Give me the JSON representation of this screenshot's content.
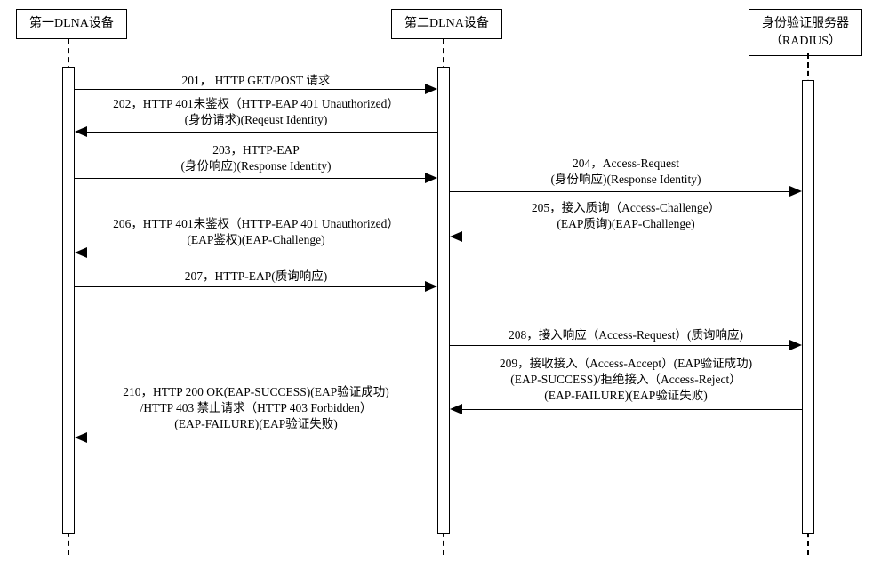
{
  "participants": {
    "p1": "第一DLNA设备",
    "p2": "第二DLNA设备",
    "p3_line1": "身份验证服务器",
    "p3_line2": "（RADIUS）"
  },
  "messages": {
    "m201": "201， HTTP GET/POST 请求",
    "m202_l1": "202，HTTP 401未鉴权（HTTP-EAP 401 Unauthorized）",
    "m202_l2": "(身份请求)(Reqeust Identity)",
    "m203_l1": "203，HTTP-EAP",
    "m203_l2": "(身份响应)(Response Identity)",
    "m204_l1": "204，Access-Request",
    "m204_l2": "(身份响应)(Response Identity)",
    "m205_l1": "205，接入质询（Access-Challenge）",
    "m205_l2": "(EAP质询)(EAP-Challenge)",
    "m206_l1": "206，HTTP 401未鉴权（HTTP-EAP 401 Unauthorized）",
    "m206_l2": "(EAP鉴权)(EAP-Challenge)",
    "m207": "207，HTTP-EAP(质询响应)",
    "m208": "208，接入响应（Access-Request）(质询响应)",
    "m209_l1": "209，接收接入（Access-Accept）(EAP验证成功)",
    "m209_l2": "(EAP-SUCCESS)/拒绝接入（Access-Reject）",
    "m209_l3": "(EAP-FAILURE)(EAP验证失败)",
    "m210_l1": "210，HTTP 200 OK(EAP-SUCCESS)(EAP验证成功)",
    "m210_l2": "/HTTP 403 禁止请求（HTTP 403 Forbidden）",
    "m210_l3": "(EAP-FAILURE)(EAP验证失败)"
  },
  "chart_data": {
    "type": "sequence-diagram",
    "participants": [
      {
        "id": "dlna1",
        "name": "第一DLNA设备"
      },
      {
        "id": "dlna2",
        "name": "第二DLNA设备"
      },
      {
        "id": "radius",
        "name": "身份验证服务器（RADIUS）"
      }
    ],
    "messages": [
      {
        "step": "201",
        "from": "dlna1",
        "to": "dlna2",
        "text": "HTTP GET/POST 请求"
      },
      {
        "step": "202",
        "from": "dlna2",
        "to": "dlna1",
        "text": "HTTP 401未鉴权（HTTP-EAP 401 Unauthorized）(身份请求)(Reqeust Identity)"
      },
      {
        "step": "203",
        "from": "dlna1",
        "to": "dlna2",
        "text": "HTTP-EAP (身份响应)(Response Identity)"
      },
      {
        "step": "204",
        "from": "dlna2",
        "to": "radius",
        "text": "Access-Request (身份响应)(Response Identity)"
      },
      {
        "step": "205",
        "from": "radius",
        "to": "dlna2",
        "text": "接入质询（Access-Challenge）(EAP质询)(EAP-Challenge)"
      },
      {
        "step": "206",
        "from": "dlna2",
        "to": "dlna1",
        "text": "HTTP 401未鉴权（HTTP-EAP 401 Unauthorized）(EAP鉴权)(EAP-Challenge)"
      },
      {
        "step": "207",
        "from": "dlna1",
        "to": "dlna2",
        "text": "HTTP-EAP(质询响应)"
      },
      {
        "step": "208",
        "from": "dlna2",
        "to": "radius",
        "text": "接入响应（Access-Request）(质询响应)"
      },
      {
        "step": "209",
        "from": "radius",
        "to": "dlna2",
        "text": "接收接入（Access-Accept）(EAP验证成功)(EAP-SUCCESS)/拒绝接入（Access-Reject）(EAP-FAILURE)(EAP验证失败)"
      },
      {
        "step": "210",
        "from": "dlna2",
        "to": "dlna1",
        "text": "HTTP 200 OK(EAP-SUCCESS)(EAP验证成功)/HTTP 403 禁止请求（HTTP 403 Forbidden）(EAP-FAILURE)(EAP验证失败)"
      }
    ]
  }
}
